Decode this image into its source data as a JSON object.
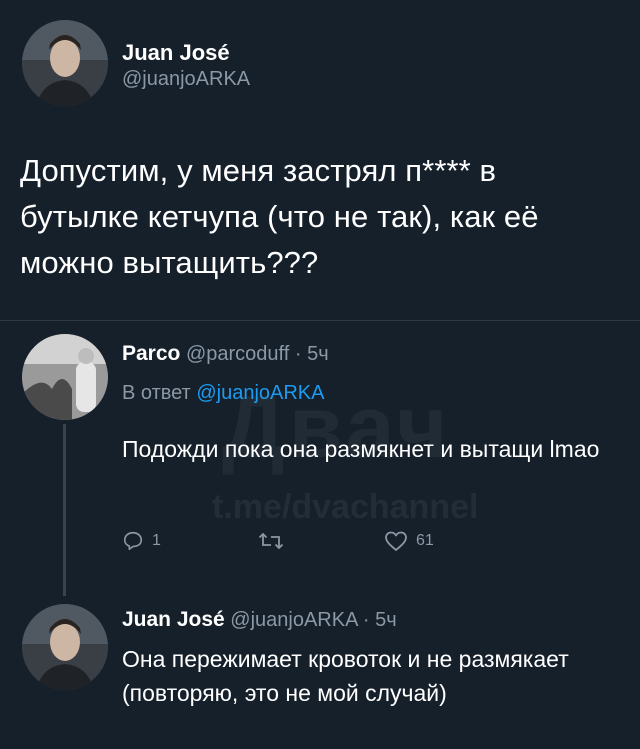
{
  "tweet": {
    "author_name": "Juan José",
    "author_handle": "@juanjoARKA",
    "text": "Допустим, у меня застрял п**** в бутылке кетчупа (что не так), как её можно вытащить???"
  },
  "reply": {
    "author_name": "Parco",
    "author_handle": "@parcoduff",
    "sep": "·",
    "time": "5ч",
    "reply_to_label": "В ответ",
    "reply_to_handle": "@juanjoARKA",
    "text": "Подожди пока она размякнет и вытащи lmao",
    "actions": {
      "reply_count": "1",
      "retweet_count": "",
      "like_count": "61"
    }
  },
  "reply2": {
    "author_name": "Juan José",
    "author_handle": "@juanjoARKA",
    "sep": "·",
    "time": "5ч",
    "text": "Она пережимает кровоток и не размякает (повторяю, это не мой случай)"
  },
  "watermark": {
    "logo": "Двач",
    "sub": "t.me/dvachannel"
  },
  "colors": {
    "background": "#15202b",
    "link": "#1d9bf0",
    "muted": "#8b98a5"
  },
  "icons": [
    "reply-icon",
    "retweet-icon",
    "like-icon"
  ]
}
